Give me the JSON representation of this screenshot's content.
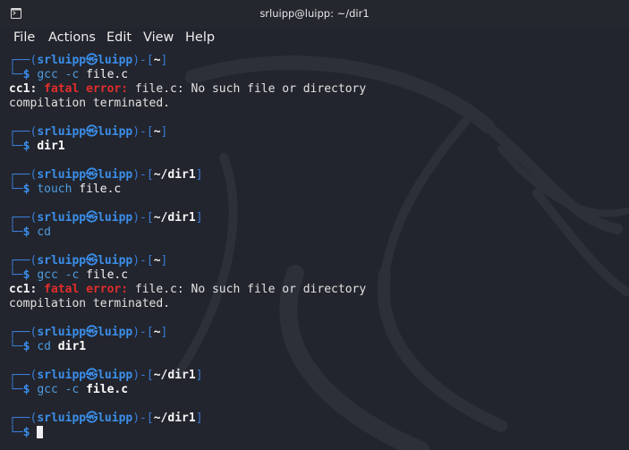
{
  "window": {
    "title": "srluipp@luipp: ~/dir1",
    "icon": "terminal-icon"
  },
  "menu": [
    "File",
    "Actions",
    "Edit",
    "View",
    "Help"
  ],
  "prompt": {
    "top_prefix": "┌──(",
    "user": "srluipp",
    "at": "㉿",
    "host": "luipp",
    "mid": ")-[",
    "end": "]",
    "bottom_prefix": "└─",
    "dollar": "$"
  },
  "blocks": [
    {
      "path": "~",
      "cmd": "gcc",
      "args": [
        {
          "text": "-c",
          "bold": false
        },
        {
          "text": "file.c",
          "bold": false
        }
      ],
      "output": [
        {
          "prefix": "cc1: ",
          "error": "fatal error: ",
          "text": "file.c: No such file or directory"
        },
        {
          "text": "compilation terminated."
        }
      ]
    },
    {
      "path": "~",
      "cmd": "",
      "args": [
        {
          "text": "dir1",
          "bold": true
        }
      ],
      "output": []
    },
    {
      "path": "~/dir1",
      "cmd": "touch",
      "args": [
        {
          "text": "file.c",
          "bold": false
        }
      ],
      "output": []
    },
    {
      "path": "~/dir1",
      "cmd": "cd",
      "args": [],
      "output": []
    },
    {
      "path": "~",
      "cmd": "gcc",
      "args": [
        {
          "text": "-c",
          "bold": false
        },
        {
          "text": "file.c",
          "bold": false
        }
      ],
      "output": [
        {
          "prefix": "cc1: ",
          "error": "fatal error: ",
          "text": "file.c: No such file or directory"
        },
        {
          "text": "compilation terminated."
        }
      ]
    },
    {
      "path": "~",
      "cmd": "cd",
      "args": [
        {
          "text": "dir1",
          "bold": true
        }
      ],
      "output": []
    },
    {
      "path": "~/dir1",
      "cmd": "gcc",
      "args": [
        {
          "text": "-c",
          "bold": false
        },
        {
          "text": "file.c",
          "bold": true
        }
      ],
      "output": []
    },
    {
      "path": "~/dir1",
      "cmd": "",
      "args": [],
      "output": [],
      "cursor": true
    }
  ],
  "colors": {
    "background": "#22252d",
    "prompt_blue": "#3b8eea",
    "error_red": "#e12d2d",
    "text": "#e2e2e2"
  }
}
